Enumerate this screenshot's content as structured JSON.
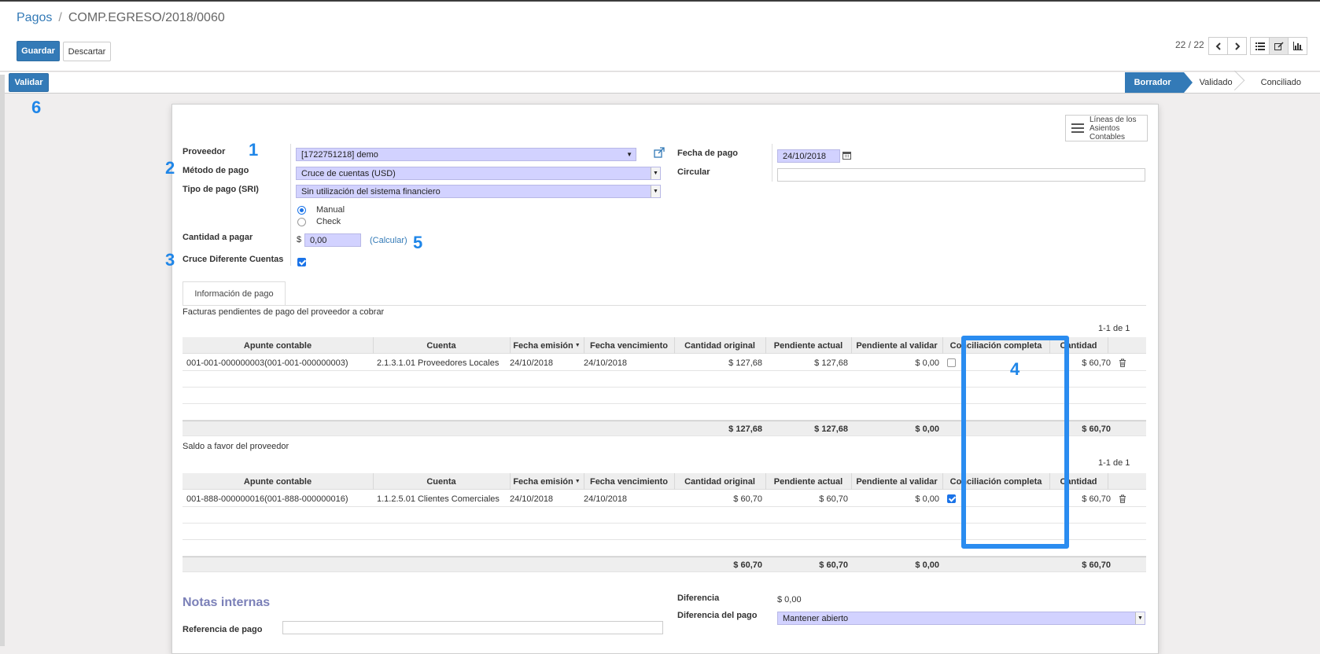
{
  "breadcrumb": {
    "parent": "Pagos",
    "separator": "/",
    "current": "COMP.EGRESO/2018/0060"
  },
  "toolbar": {
    "save_label": "Guardar",
    "discard_label": "Descartar",
    "pager": "22 / 22"
  },
  "statusbar": {
    "validate_label": "Validar",
    "steps": [
      "Borrador",
      "Validado",
      "Conciliado"
    ],
    "current_step": "Borrador"
  },
  "annotations": [
    "1",
    "2",
    "3",
    "4",
    "5",
    "6"
  ],
  "sheet": {
    "lines_button": [
      "Líneas de los",
      "Asientos",
      "Contables"
    ],
    "proveedor": {
      "label": "Proveedor",
      "value": "[1722751218] demo"
    },
    "metodo": {
      "label": "Método de pago",
      "value": "Cruce de cuentas (USD)"
    },
    "tipo_sri": {
      "label": "Tipo de pago (SRI)",
      "value": "Sin utilización del sistema financiero"
    },
    "radio": {
      "options": [
        "Manual",
        "Check"
      ],
      "selected": "Manual"
    },
    "cantidad": {
      "label": "Cantidad a pagar",
      "currency": "$",
      "value": "0,00",
      "calc_link": "(Calcular)"
    },
    "cruce": {
      "label": "Cruce Diferente Cuentas",
      "checked": true
    },
    "fecha": {
      "label": "Fecha de pago",
      "value": "24/10/2018"
    },
    "circular": {
      "label": "Circular",
      "value": ""
    },
    "tab_label": "Información de pago",
    "section1_title": "Facturas pendientes de pago del proveedor a cobrar",
    "section2_title": "Saldo a favor del proveedor",
    "pager1": "1-1 de 1",
    "pager2": "1-1 de 1",
    "columns": [
      "Apunte contable",
      "Cuenta",
      "Fecha emisión",
      "Fecha vencimiento",
      "Cantidad original",
      "Pendiente actual",
      "Pendiente al validar",
      "Conciliación completa",
      "Cantidad"
    ],
    "table1": {
      "row": [
        "001-001-000000003(001-001-000000003)",
        "2.1.3.1.01 Proveedores Locales",
        "24/10/2018",
        "24/10/2018",
        "$ 127,68",
        "$ 127,68",
        "$ 0,00",
        "",
        "$ 60,70"
      ],
      "reconciled": false,
      "totals": [
        "$ 127,68",
        "$ 127,68",
        "$ 0,00",
        "$ 60,70"
      ]
    },
    "table2": {
      "row": [
        "001-888-000000016(001-888-000000016)",
        "1.1.2.5.01 Clientes Comerciales",
        "24/10/2018",
        "24/10/2018",
        "$ 60,70",
        "$ 60,70",
        "$ 0,00",
        "",
        "$ 60,70"
      ],
      "reconciled": true,
      "totals": [
        "$ 60,70",
        "$ 60,70",
        "$ 0,00",
        "$ 60,70"
      ]
    },
    "notes_title": "Notas internas",
    "referencia": {
      "label": "Referencia de pago",
      "value": ""
    },
    "diferencia": {
      "label": "Diferencia",
      "value": "$ 0,00"
    },
    "diferencia_pago": {
      "label": "Diferencia del pago",
      "value": "Mantener abierto"
    }
  },
  "colors": {
    "primary": "#337ab7",
    "required_field": "#d2d2ff",
    "annotation": "#2a8cf0"
  }
}
